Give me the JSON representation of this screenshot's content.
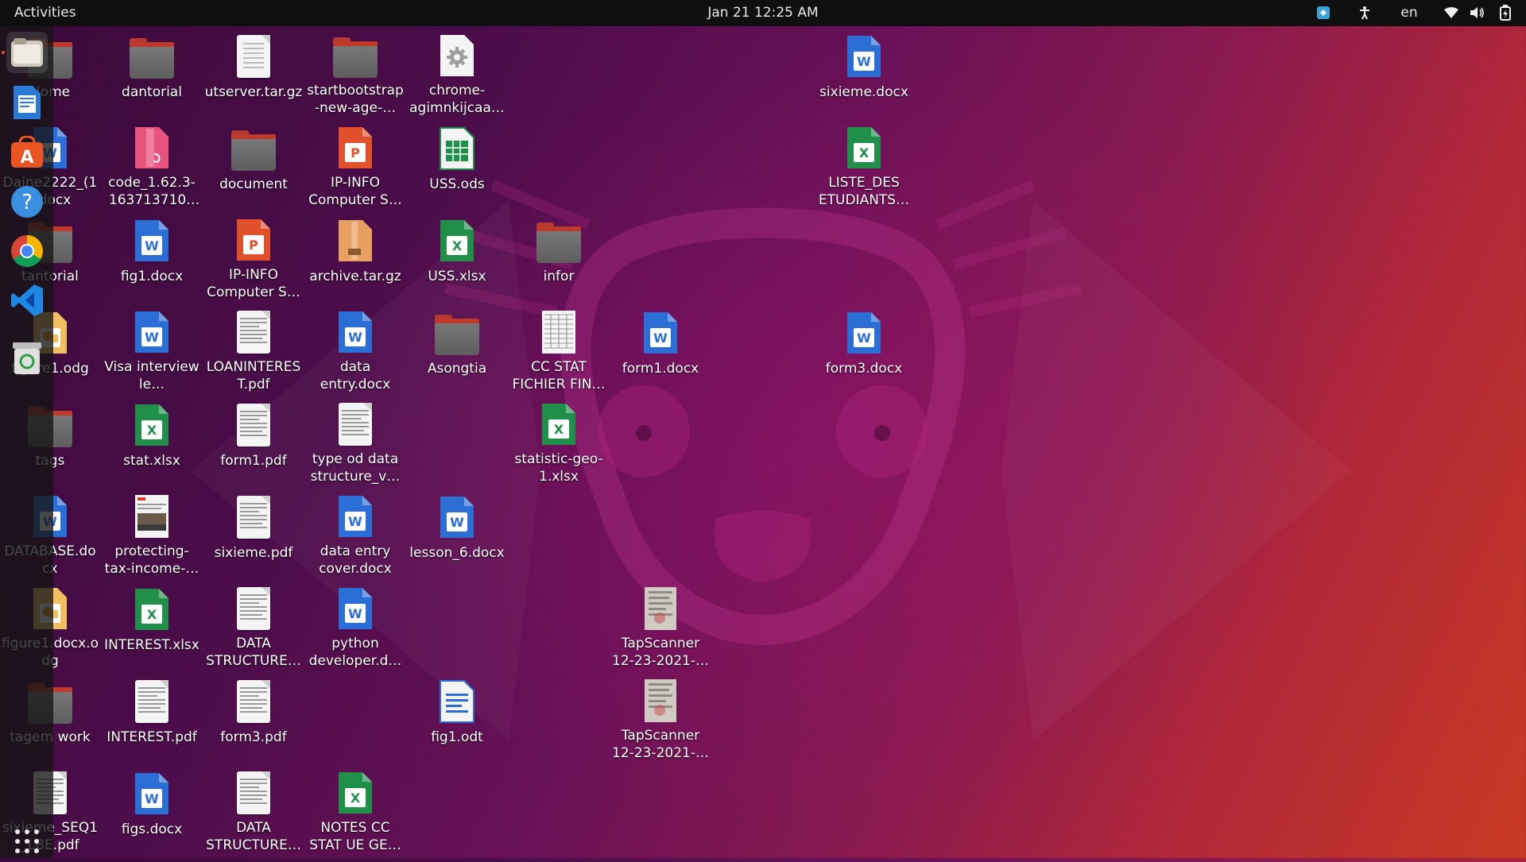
{
  "topbar": {
    "activities": "Activities",
    "clock": "Jan 21  12:25 AM",
    "language": "en",
    "tray_icons": [
      "tray-app-icon",
      "accessibility-icon",
      "wifi-icon",
      "volume-icon",
      "battery-icon"
    ]
  },
  "dock": {
    "items": [
      "files",
      "libreoffice-writer",
      "ubuntu-software",
      "help",
      "chrome",
      "vscode",
      "trash"
    ],
    "show_apps": "apps-grid"
  },
  "desktop": {
    "items": [
      {
        "label": "Home",
        "type": "folder"
      },
      {
        "label": "dantorial",
        "type": "folder"
      },
      {
        "label": "utserver.tar.gz",
        "type": "archive-text"
      },
      {
        "label": "startbootstrap-new-age-…",
        "type": "folder"
      },
      {
        "label": "chrome-agimnkijcaa…",
        "type": "gear"
      },
      {
        "label": "sixieme.docx",
        "type": "word"
      },
      {
        "label": "Daine2222_(1).docx",
        "type": "word"
      },
      {
        "label": "code_1.62.3-1637137107…",
        "type": "deb"
      },
      {
        "label": "document",
        "type": "folder"
      },
      {
        "label": "IP-INFO Computer S…",
        "type": "ppt"
      },
      {
        "label": "USS.ods",
        "type": "ods"
      },
      {
        "label": "LISTE_DES ETUDIANTS…",
        "type": "excel"
      },
      {
        "label": "tantorial",
        "type": "folder"
      },
      {
        "label": "fig1.docx",
        "type": "word"
      },
      {
        "label": "IP-INFO Computer S…",
        "type": "ppt"
      },
      {
        "label": "archive.tar.gz",
        "type": "archive"
      },
      {
        "label": "USS.xlsx",
        "type": "excel"
      },
      {
        "label": "infor",
        "type": "folder"
      },
      {
        "label": "figure1.odg",
        "type": "odg"
      },
      {
        "label": "Visa interview le…",
        "type": "word"
      },
      {
        "label": "LOANINTEREST.pdf",
        "type": "pdf"
      },
      {
        "label": "data entry.docx",
        "type": "word"
      },
      {
        "label": "Asongtia",
        "type": "folder"
      },
      {
        "label": "CC STAT FICHIER FIN…",
        "type": "pdf-table"
      },
      {
        "label": "form1.docx",
        "type": "word"
      },
      {
        "label": "form3.docx",
        "type": "word"
      },
      {
        "label": "tags",
        "type": "folder"
      },
      {
        "label": "stat.xlsx",
        "type": "excel"
      },
      {
        "label": "form1.pdf",
        "type": "pdf"
      },
      {
        "label": "type od data structure_v…",
        "type": "pdf"
      },
      {
        "label": "statistic-geo-1.xlsx",
        "type": "excel"
      },
      {
        "label": "DATABASE.docx",
        "type": "word"
      },
      {
        "label": "protecting-tax-income-…",
        "type": "pdf-photo"
      },
      {
        "label": "sixieme.pdf",
        "type": "pdf"
      },
      {
        "label": "data entry cover.docx",
        "type": "word"
      },
      {
        "label": "lesson_6.docx",
        "type": "word"
      },
      {
        "label": "figure1.docx.odg",
        "type": "odg"
      },
      {
        "label": "INTEREST.xlsx",
        "type": "excel"
      },
      {
        "label": "DATA STRUCTURE…",
        "type": "pdf"
      },
      {
        "label": "python developer.d…",
        "type": "word"
      },
      {
        "label": "TapScanner 12-23-2021-…",
        "type": "scan"
      },
      {
        "label": "tagem work",
        "type": "folder"
      },
      {
        "label": "INTEREST.pdf",
        "type": "pdf"
      },
      {
        "label": "form3.pdf",
        "type": "pdf"
      },
      {
        "label": "fig1.odt",
        "type": "odt"
      },
      {
        "label": "TapScanner 12-23-2021-…",
        "type": "scan"
      },
      {
        "label": "sixieme_SEQ1_LBE.pdf",
        "type": "pdf"
      },
      {
        "label": "figs.docx",
        "type": "word"
      },
      {
        "label": "DATA STRUCTURE…",
        "type": "pdf"
      },
      {
        "label": "NOTES CC STAT UE GE…",
        "type": "excel"
      }
    ]
  },
  "colors": {
    "topbar": "#0f0f0f",
    "dock_bg": "#141414",
    "folder": "#6b6b6b",
    "folder_tab": "#c0392b",
    "word": "#2b6fd6",
    "excel": "#1f8f4a",
    "ppt": "#e0502a",
    "deb": "#e75480",
    "archive": "#e8a060",
    "ubuntu_orange": "#e95420"
  }
}
